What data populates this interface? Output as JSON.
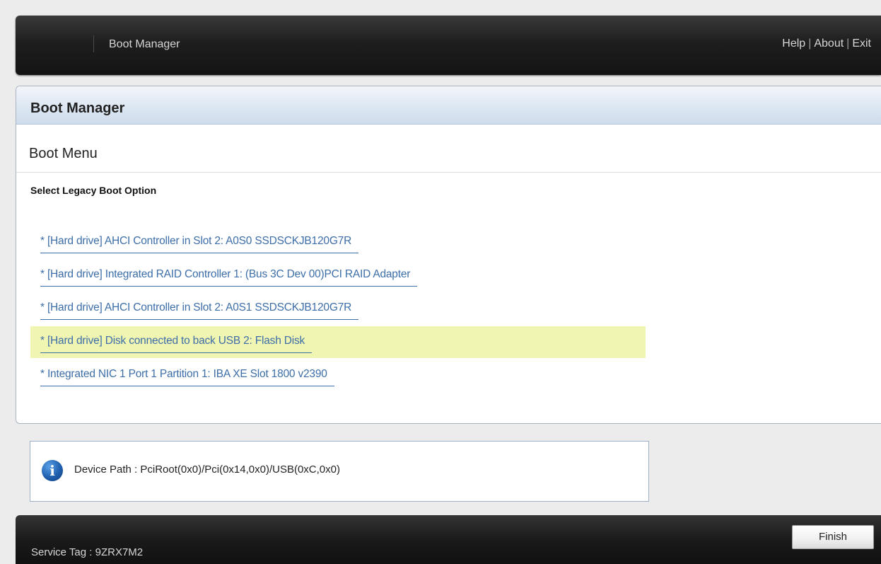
{
  "header": {
    "title": "Boot Manager",
    "links": [
      "Help",
      "About",
      "Exit"
    ],
    "separator": "|"
  },
  "panel": {
    "title": "Boot Manager",
    "section_title": "Boot Menu",
    "sub_label": "Select Legacy Boot Option",
    "boot_options": [
      {
        "label": "* [Hard drive] AHCI Controller in Slot 2: A0S0 SSDSCKJB120G7R",
        "selected": false
      },
      {
        "label": "* [Hard drive] Integrated RAID Controller 1: (Bus 3C Dev 00)PCI RAID Adapter",
        "selected": false
      },
      {
        "label": "* [Hard drive] AHCI Controller in Slot 2: A0S1 SSDSCKJB120G7R",
        "selected": false
      },
      {
        "label": "* [Hard drive] Disk connected to back USB 2: Flash Disk",
        "selected": true
      },
      {
        "label": "* Integrated NIC 1 Port 1 Partition 1: IBA XE Slot 1800 v2390",
        "selected": false
      }
    ]
  },
  "info": {
    "icon": "info-icon",
    "device_path": "Device Path : PciRoot(0x0)/Pci(0x14,0x0)/USB(0xC,0x0)"
  },
  "footer": {
    "service_tag": "Service Tag : 9ZRX7M2",
    "finish_label": "Finish"
  },
  "colors": {
    "link": "#3d6ea8",
    "selected_highlight": "#f0f5b2",
    "bar_dark": "#1e1e1e"
  }
}
